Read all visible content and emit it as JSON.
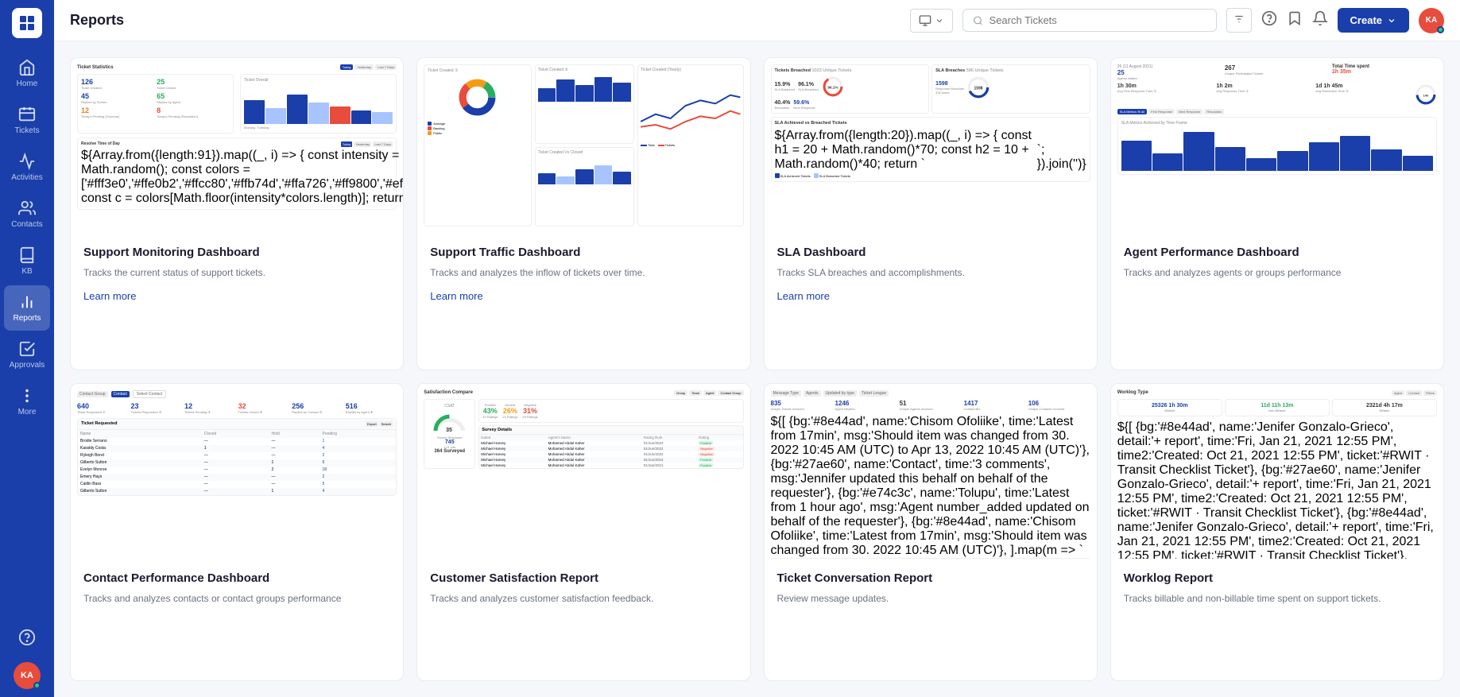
{
  "header": {
    "title": "Reports",
    "search_placeholder": "Search Tickets",
    "create_label": "Create",
    "filter_title": "Filter"
  },
  "sidebar": {
    "items": [
      {
        "id": "home",
        "label": "Home"
      },
      {
        "id": "tickets",
        "label": "Tickets"
      },
      {
        "id": "activities",
        "label": "Activities"
      },
      {
        "id": "contacts",
        "label": "Contacts"
      },
      {
        "id": "kb",
        "label": "KB"
      },
      {
        "id": "reports",
        "label": "Reports"
      },
      {
        "id": "approvals",
        "label": "Approvals"
      },
      {
        "id": "more",
        "label": "More"
      }
    ],
    "user_initials": "KA"
  },
  "cards": [
    {
      "id": "support-monitoring",
      "title": "Support Monitoring Dashboard",
      "description": "Tracks the current status of support tickets.",
      "link_label": "Learn more",
      "stats": {
        "tickets_created": 126,
        "tickets_closed": 25,
        "replies_by_screen": 45,
        "replies_by_agent": 65,
        "todays_pending_new": 12,
        "todays_pending_resolved": 8
      }
    },
    {
      "id": "support-traffic",
      "title": "Support Traffic Dashboard",
      "description": "Tracks and analyzes the inflow of tickets over time.",
      "link_label": "Learn more"
    },
    {
      "id": "sla",
      "title": "SLA Dashboard",
      "description": "Tracks SLA breaches and accomplishments.",
      "link_label": "Learn more",
      "stats": {
        "tickets_breached_pct": "15.9%",
        "sla_breached_pct": "96.1%",
        "resolution_pct": "40.4%",
        "next_response_pct": "59.6%"
      }
    },
    {
      "id": "agent-performance",
      "title": "Agent Performance Dashboard",
      "description": "Tracks and analyzes agents or groups performance"
    },
    {
      "id": "contact-performance",
      "title": "Contact Performance Dashboard",
      "description": "Tracks and analyzes contacts or contact groups performance",
      "stats": {
        "ticket_requested": 640,
        "tickets_responded": 23,
        "tickets_pending": 12,
        "tickets_closed": 32,
        "replies_by_contact": 256,
        "replies_by_agent": 516
      }
    },
    {
      "id": "csat",
      "title": "Customer Satisfaction Report",
      "description": "Tracks and analyzes customer satisfaction feedback.",
      "stats": {
        "csat": 35,
        "positive": "43%",
        "neutral": "26%",
        "negative": "31%",
        "survey_responses": 745,
        "surveyed": 364
      }
    },
    {
      "id": "ticket-conversation",
      "title": "Ticket Conversation Report",
      "description": "Review message updates.",
      "stats": {
        "unique_tickets": 835,
        "agent_replies": 1246,
        "unique_agents": 51,
        "contact_biz": 1417,
        "unique_contacts": 106
      }
    },
    {
      "id": "worklog",
      "title": "Worklog Report",
      "description": "Tracks billable and non-billable time spent on support tickets.",
      "stats": {
        "total_1": "25326 1h 30m",
        "total_2": "11d 11h 13m",
        "total_3": "2321d 4h 17m"
      }
    }
  ]
}
